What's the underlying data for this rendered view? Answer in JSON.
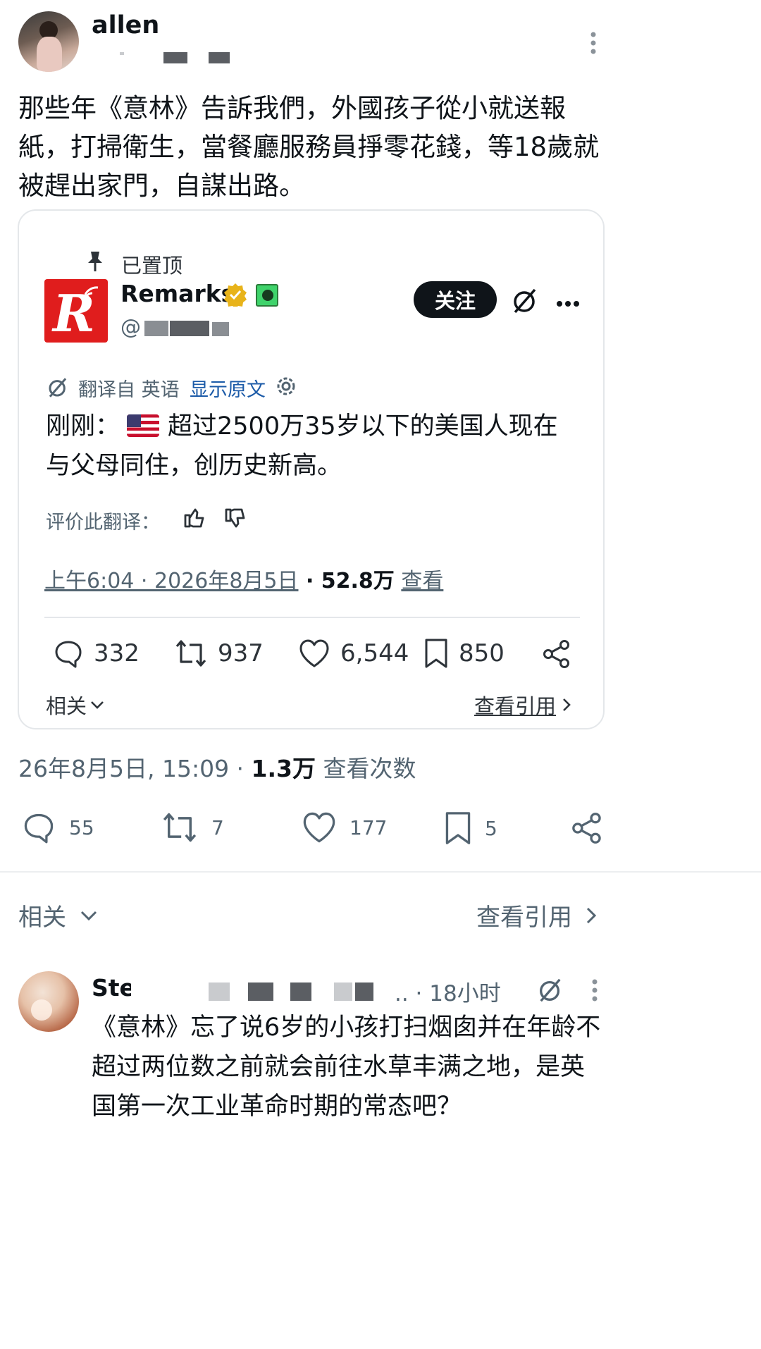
{
  "post": {
    "author": "allen",
    "text": "那些年《意林》告訴我們，外國孩子從小就送報紙，打掃衛生，當餐廳服務員掙零花錢，等18歲就被趕出家門，自謀出路。",
    "meta_time": "26年8月5日, 15:09 · ",
    "meta_views": "1.3万",
    "meta_views_label": " 查看次数",
    "stats": {
      "replies": "55",
      "reposts": "7",
      "likes": "177",
      "bookmarks": "5"
    },
    "related": "相关",
    "view_quotes": "查看引用"
  },
  "quoted": {
    "pinned": "已置顶",
    "name": "Remarks",
    "handle": "@",
    "follow": "关注",
    "translate_label": "翻译自 英语",
    "show_original": "显示原文",
    "text_prefix": "刚刚：",
    "text_body": "超过2500万35岁以下的美国人现在与父母同住，创历史新高。",
    "rate_translation": "评价此翻译：",
    "timestamp": "上午6:04 · 2026年8月5日",
    "views": " · 52.8万",
    "views_label": "查看",
    "stats": {
      "replies": "332",
      "reposts": "937",
      "likes": "6,544",
      "bookmarks": "850"
    },
    "related": "相关",
    "view_quotes": "查看引用"
  },
  "reply": {
    "author": "Ste",
    "time": ".. · 18小时",
    "text": "《意林》忘了说6岁的小孩打扫烟囱并在年龄不超过两位数之前就会前往水草丰满之地，是英国第一次工业革命时期的常态吧？"
  },
  "icons": {
    "more": "more-vertical-icon",
    "pin": "pin-icon",
    "verified": "verified-badge-icon",
    "grok": "grok-icon",
    "reply": "reply-icon",
    "repost": "repost-icon",
    "like": "heart-icon",
    "bookmark": "bookmark-icon",
    "share": "share-icon"
  },
  "colors": {
    "accent": "#1d9bf0",
    "link": "#1c5ba8",
    "logo_red": "#e01d1d",
    "verified": "#e8b31a"
  }
}
